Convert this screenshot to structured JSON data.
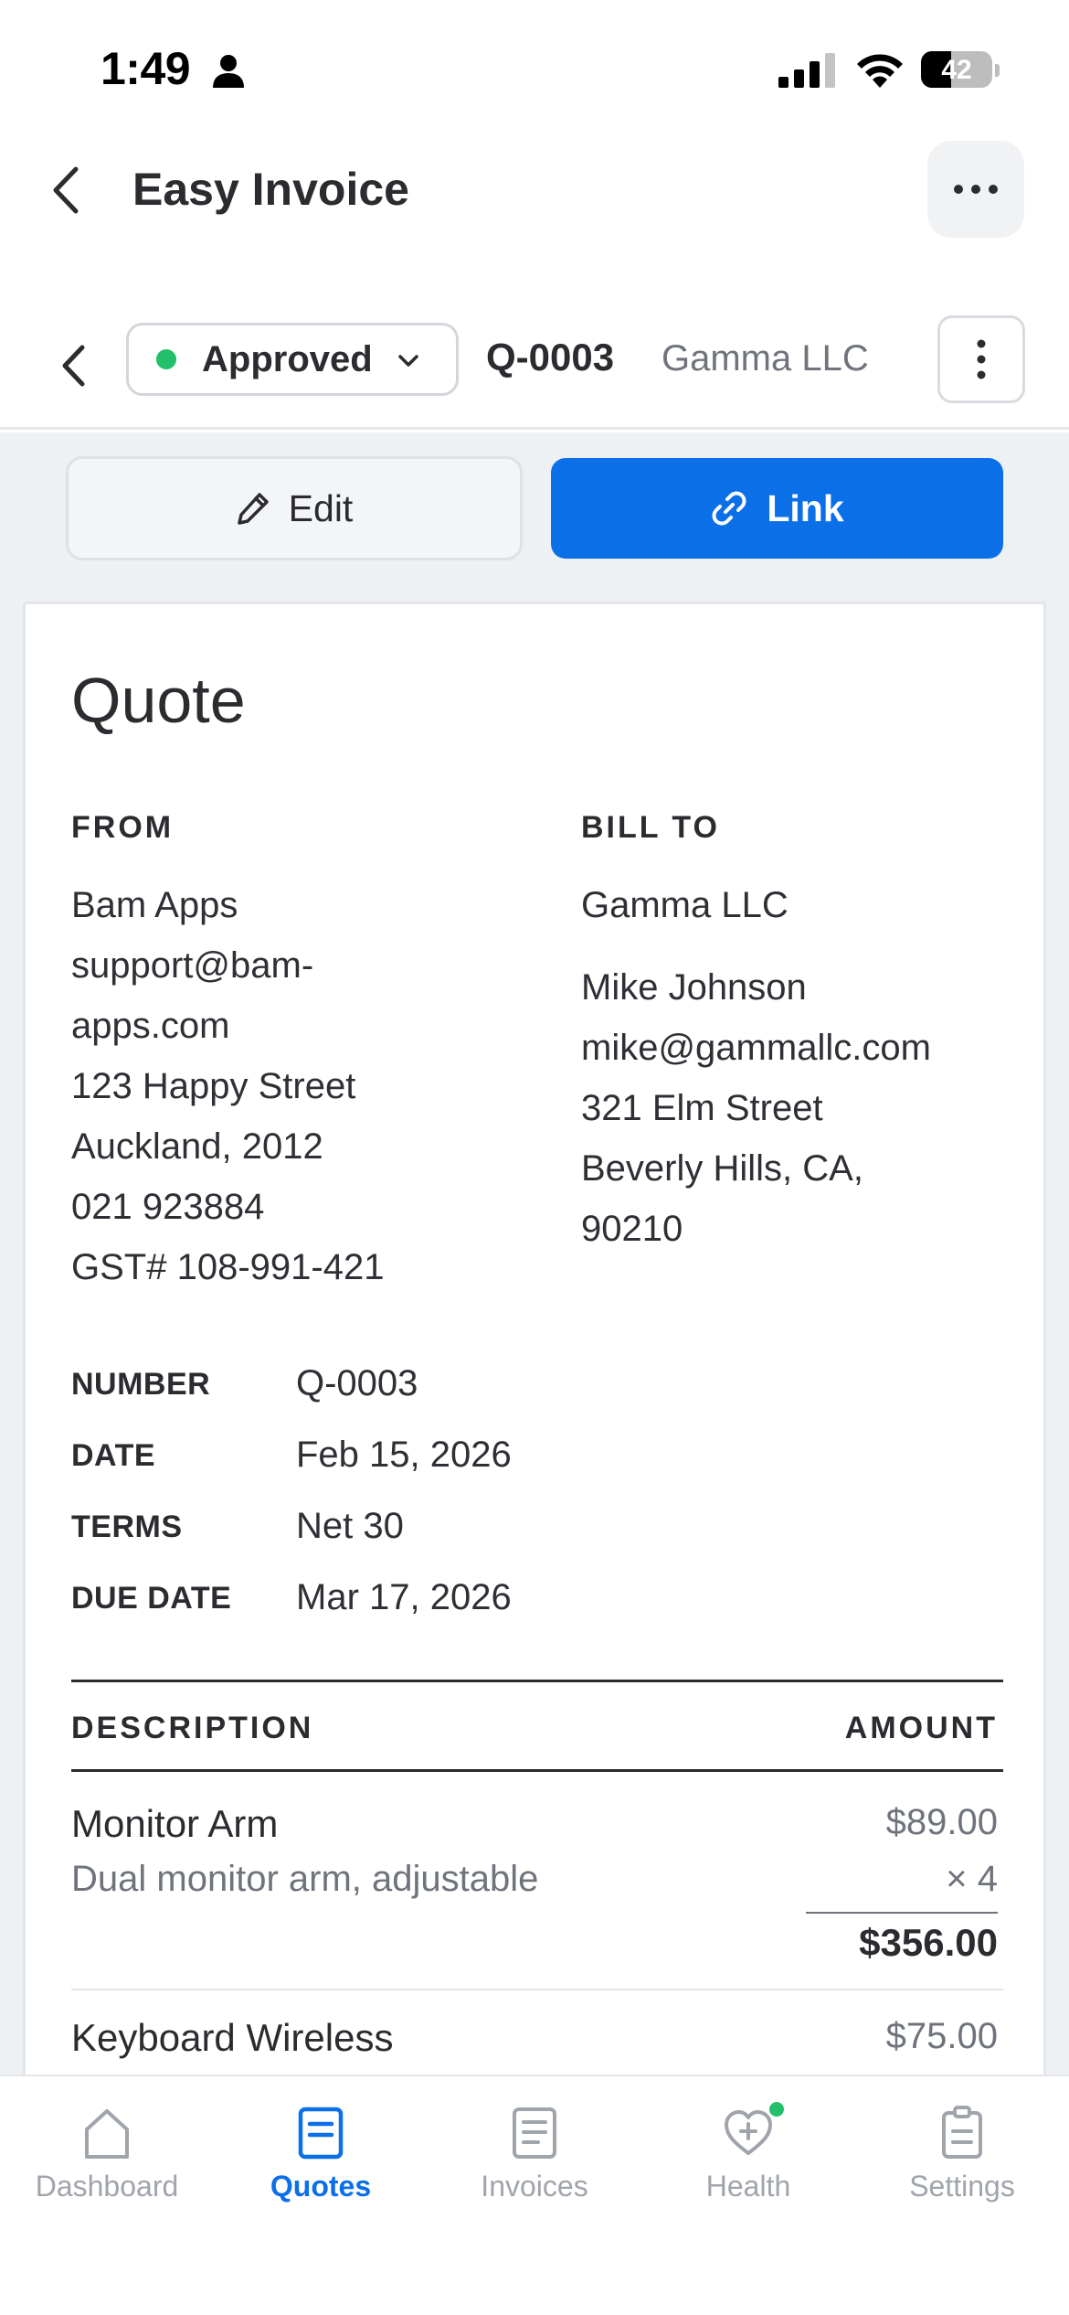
{
  "status_bar": {
    "time": "1:49",
    "battery": "42",
    "battery_level": 0.42
  },
  "header": {
    "title": "Easy Invoice"
  },
  "document_bar": {
    "status": "Approved",
    "status_color": "#22c06a",
    "number": "Q-0003",
    "client": "Gamma LLC"
  },
  "actions": {
    "edit_label": "Edit",
    "link_label": "Link",
    "accent": "#0b6fe8"
  },
  "document": {
    "heading": "Quote",
    "from": {
      "label": "FROM",
      "lines": [
        "Bam Apps",
        "support@bam-",
        "apps.com",
        "123 Happy Street",
        "Auckland, 2012",
        "021 923884",
        "GST# 108-991-421"
      ]
    },
    "bill_to": {
      "label": "BILL TO",
      "company": "Gamma LLC",
      "lines": [
        "Mike Johnson",
        "mike@gammallc.com",
        "321 Elm Street",
        "Beverly Hills, CA,",
        "90210"
      ]
    },
    "meta": [
      {
        "key": "NUMBER",
        "value": "Q-0003"
      },
      {
        "key": "DATE",
        "value": "Feb 15, 2026"
      },
      {
        "key": "TERMS",
        "value": "Net 30"
      },
      {
        "key": "DUE DATE",
        "value": "Mar 17, 2026"
      }
    ],
    "table": {
      "col_description": "DESCRIPTION",
      "col_amount": "AMOUNT",
      "items": [
        {
          "name": "Monitor Arm",
          "description": "Dual monitor arm, adjustable",
          "price": "$89.00",
          "qty": "× 4",
          "total": "$356.00"
        },
        {
          "name": "Keyboard Wireless",
          "price": "$75.00"
        }
      ]
    }
  },
  "tabs": [
    {
      "label": "Dashboard",
      "icon": "home-icon"
    },
    {
      "label": "Quotes",
      "icon": "quote-document-icon",
      "active": true
    },
    {
      "label": "Invoices",
      "icon": "invoice-document-icon"
    },
    {
      "label": "Health",
      "icon": "heart-plus-icon",
      "badge": true
    },
    {
      "label": "Settings",
      "icon": "clipboard-icon"
    }
  ]
}
